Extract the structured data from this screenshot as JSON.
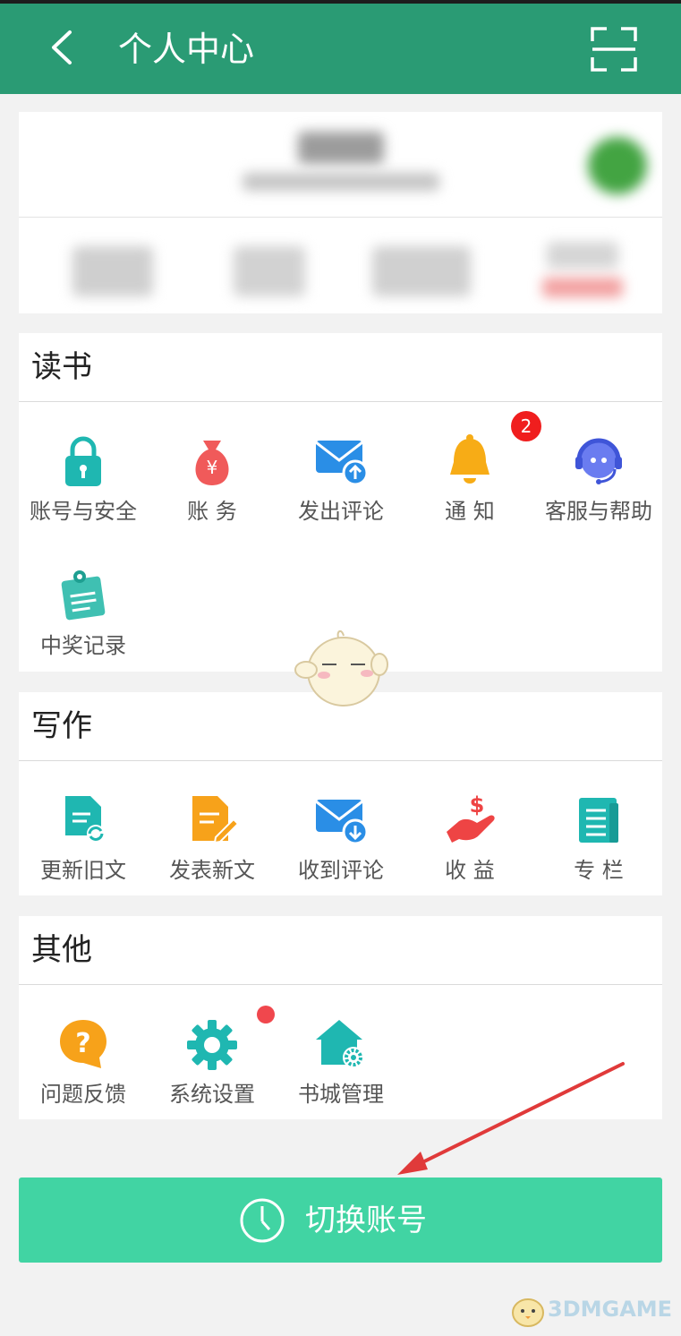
{
  "header": {
    "title": "个人中心",
    "back_icon": "chevron-left-icon",
    "scan_icon": "scan-frame-icon",
    "color": "#2a9b74"
  },
  "sections": [
    {
      "title": "读书",
      "items": [
        {
          "label": "账号与安全",
          "icon": "lock-icon"
        },
        {
          "label": "账  务",
          "icon": "money-bag-icon"
        },
        {
          "label": "发出评论",
          "icon": "mail-send-icon"
        },
        {
          "label": "通  知",
          "icon": "bell-icon",
          "badge": "2"
        },
        {
          "label": "客服与帮助",
          "icon": "headset-icon"
        },
        {
          "label": "中奖记录",
          "icon": "prize-record-icon"
        }
      ]
    },
    {
      "title": "写作",
      "items": [
        {
          "label": "更新旧文",
          "icon": "document-refresh-icon"
        },
        {
          "label": "发表新文",
          "icon": "document-edit-icon"
        },
        {
          "label": "收到评论",
          "icon": "mail-receive-icon"
        },
        {
          "label": "收  益",
          "icon": "hand-dollar-icon"
        },
        {
          "label": "专  栏",
          "icon": "column-list-icon"
        }
      ]
    },
    {
      "title": "其他",
      "items": [
        {
          "label": "问题反馈",
          "icon": "question-bubble-icon"
        },
        {
          "label": "系统设置",
          "icon": "gear-icon",
          "dot": true
        },
        {
          "label": "书城管理",
          "icon": "house-gear-icon"
        }
      ]
    }
  ],
  "switch_account": {
    "label": "切换账号",
    "icon": "clock-icon",
    "color": "#41d4a3"
  },
  "watermark": {
    "text": "3DMGAME"
  }
}
